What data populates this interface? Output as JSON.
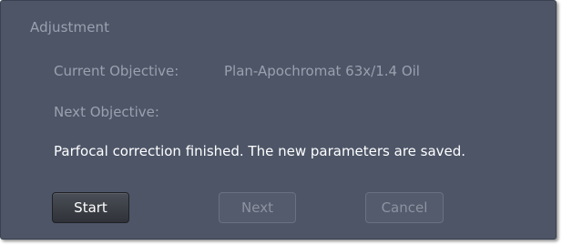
{
  "section": {
    "title": "Adjustment"
  },
  "objective": {
    "current_label": "Current Objective:",
    "current_value": "Plan-Apochromat 63x/1.4 Oil",
    "next_label": "Next Objective:",
    "next_value": ""
  },
  "status_message": "Parfocal correction finished. The new parameters are saved.",
  "buttons": {
    "start": "Start",
    "next": "Next",
    "cancel": "Cancel"
  },
  "colors": {
    "panel_background": "#4d5567",
    "muted_text": "#9aa1ae",
    "status_text": "#ffffff"
  }
}
